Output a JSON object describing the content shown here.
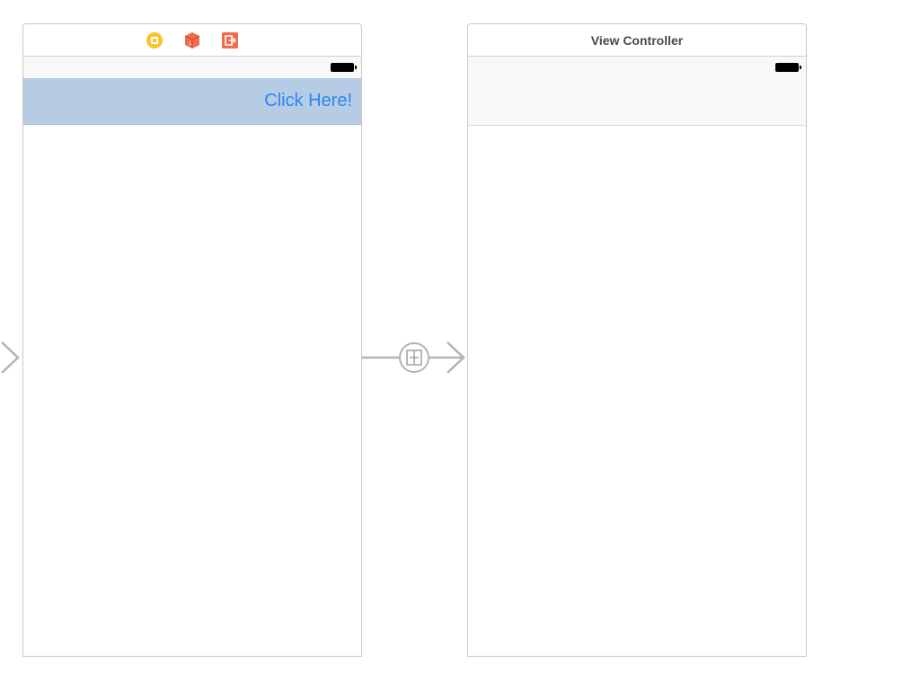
{
  "scenes": {
    "first": {
      "dock_icons": [
        "view-controller-icon",
        "first-responder-icon",
        "exit-icon"
      ],
      "button_label": "Click Here!"
    },
    "second": {
      "title": "View Controller"
    }
  },
  "segue": {
    "icon": "segue-icon"
  },
  "colors": {
    "button_bar_bg": "#b6cbe4",
    "button_text": "#2d86f0",
    "vc_icon": "#f9c42c",
    "responder_icon": "#f26a4b",
    "exit_icon": "#f26a4b",
    "connector": "#b3b3b3"
  }
}
